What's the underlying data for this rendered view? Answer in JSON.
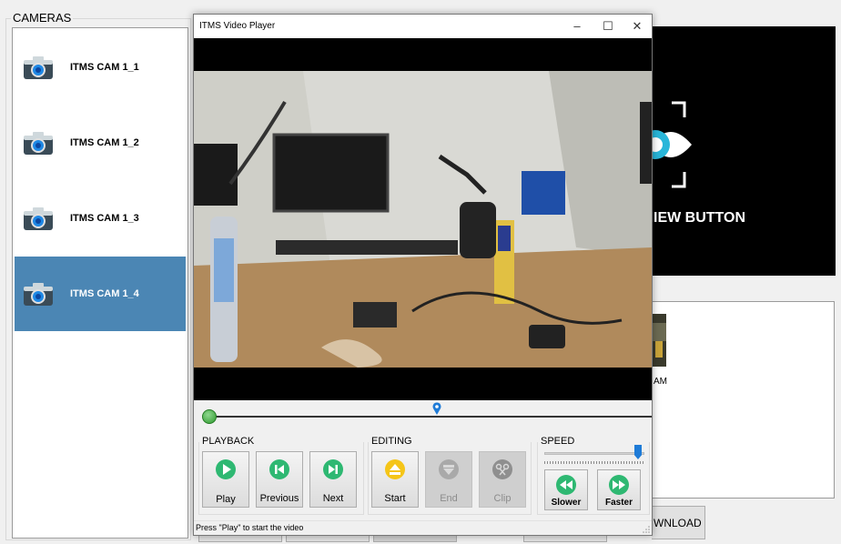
{
  "cameras": {
    "title": "CAMERAS",
    "items": [
      {
        "label": "ITMS CAM 1_1",
        "selected": false
      },
      {
        "label": "ITMS CAM 1_2",
        "selected": false
      },
      {
        "label": "ITMS CAM 1_3",
        "selected": false
      },
      {
        "label": "ITMS CAM 1_4",
        "selected": true
      }
    ]
  },
  "preview": {
    "text": "IEW BUTTON"
  },
  "recordings": {
    "thumb_label": "AM"
  },
  "download": {
    "label": "WNLOAD"
  },
  "player": {
    "title": "ITMS Video Player",
    "window_controls": {
      "minimize": "–",
      "maximize": "☐",
      "close": "✕"
    },
    "seek": {
      "progress": 0.0,
      "marker_position": 0.53
    },
    "playback": {
      "title": "PLAYBACK",
      "buttons": [
        {
          "label": "Play",
          "icon": "play-icon",
          "enabled": true
        },
        {
          "label": "Previous",
          "icon": "previous-icon",
          "enabled": true
        },
        {
          "label": "Next",
          "icon": "next-icon",
          "enabled": true
        }
      ]
    },
    "editing": {
      "title": "EDITING",
      "buttons": [
        {
          "label": "Start",
          "icon": "eject-icon",
          "enabled": true
        },
        {
          "label": "End",
          "icon": "end-icon",
          "enabled": false
        },
        {
          "label": "Clip",
          "icon": "clip-icon",
          "enabled": false
        }
      ]
    },
    "speed": {
      "title": "SPEED",
      "level": 1.0,
      "buttons": [
        {
          "label": "Slower",
          "icon": "rewind-icon"
        },
        {
          "label": "Faster",
          "icon": "fast-forward-icon"
        }
      ]
    },
    "status": "Press \"Play\" to start the video"
  },
  "colors": {
    "selection": "#4b86b4",
    "play_green": "#2eb872",
    "start_yellow": "#f5c518",
    "speed_thumb": "#1e7bd7"
  }
}
